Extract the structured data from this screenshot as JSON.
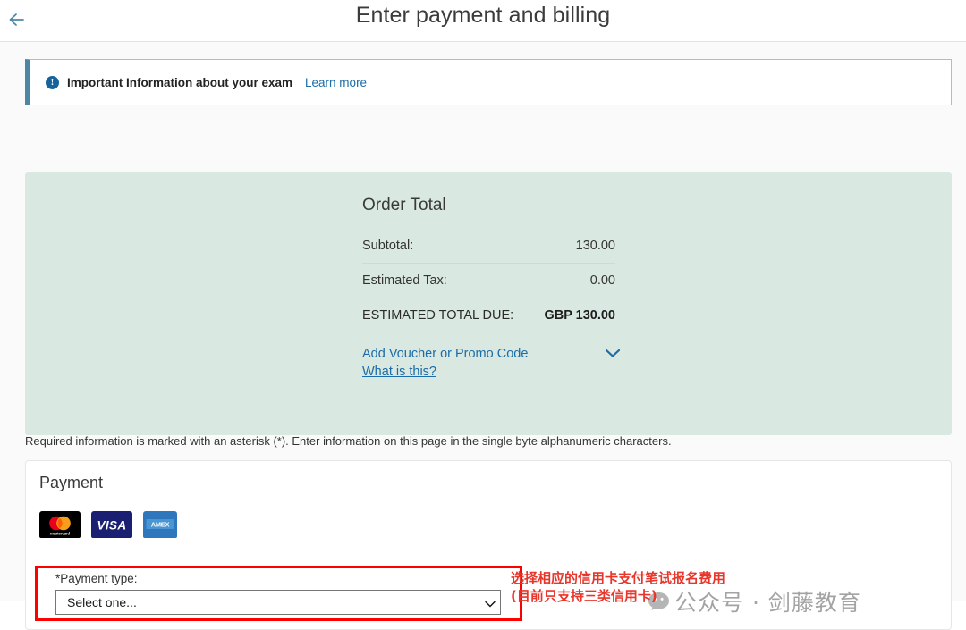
{
  "header": {
    "title": "Enter payment and billing",
    "back_label": "Back"
  },
  "banner": {
    "icon": "info-circle-icon",
    "message": "Important Information about your exam",
    "link_label": "Learn more"
  },
  "order": {
    "title": "Order Total",
    "rows": [
      {
        "label": "Subtotal:",
        "value": "130.00"
      },
      {
        "label": "Estimated Tax:",
        "value": "0.00"
      }
    ],
    "total_label": "ESTIMATED TOTAL DUE:",
    "total_value": "GBP 130.00",
    "voucher_link": "Add Voucher or Promo Code",
    "voucher_help": "What is this?",
    "chevron_icon": "chevron-down-icon"
  },
  "required_note": "Required information is marked with an asterisk (*). Enter information on this page in the single byte alphanumeric characters.",
  "payment": {
    "heading": "Payment",
    "accepted_cards": [
      {
        "name": "mastercard-logo",
        "label": "mastercard"
      },
      {
        "name": "visa-logo",
        "label": "VISA"
      },
      {
        "name": "amex-logo",
        "label": "AMEX"
      }
    ],
    "payment_type_label": "*Payment type:",
    "payment_type_value": "Select one...",
    "payment_type_options": [
      "Select one..."
    ],
    "select_chevron_icon": "chevron-down-icon"
  },
  "annotation": {
    "line1": "选择相应的信用卡支付笔试报名费用",
    "line2": "(目前只支持三类信用卡)",
    "color": "#e8362b"
  },
  "watermark": {
    "icon": "wechat-bubble-icon",
    "text": "公众号 · 剑藤教育"
  },
  "colors": {
    "accent_blue": "#1b6ca8",
    "banner_border": "#4b87a4",
    "panel_green": "#d9e8e0",
    "highlight_red": "#ff0000"
  }
}
